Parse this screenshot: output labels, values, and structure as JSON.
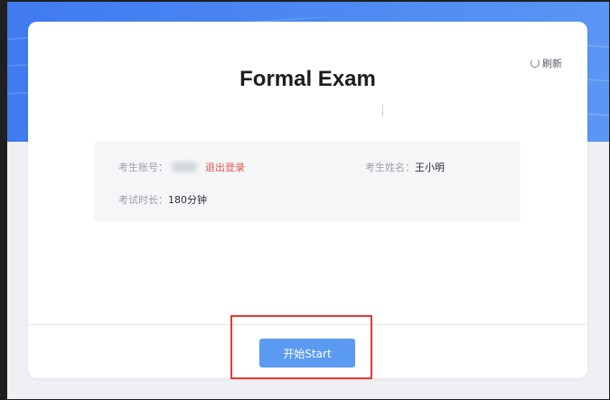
{
  "exam": {
    "title": "Formal Exam",
    "refresh_label": "刷新"
  },
  "candidate": {
    "account_label": "考生账号：",
    "logout_label": "退出登录",
    "name_label": "考生姓名：",
    "name_value": "王小明",
    "duration_label": "考试时长：",
    "duration_value": "180分钟"
  },
  "actions": {
    "start_label": "开始Start"
  },
  "colors": {
    "hero_blue": "#4d8af2",
    "start_button": "#5b9af2",
    "logout_red": "#e2574c",
    "annotation_red": "#e53935"
  },
  "icons": {
    "refresh": "refresh-icon"
  }
}
